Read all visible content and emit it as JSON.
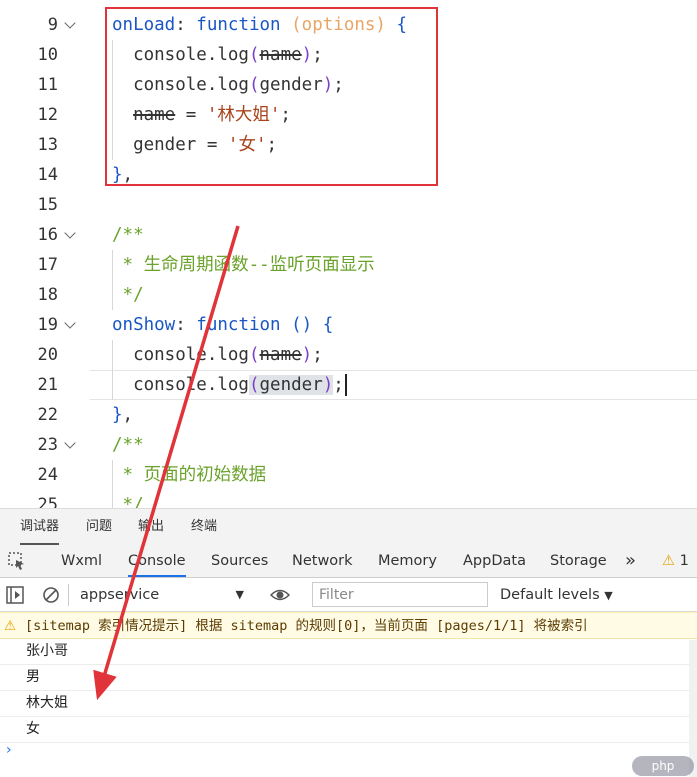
{
  "editor": {
    "lines": [
      {
        "num": "9",
        "fold": true,
        "html": "<span class=\"k\">onLoad</span>: <span class=\"k\">function</span> <span class=\"o\">(options)</span> <span class=\"k\">{</span>"
      },
      {
        "num": "10",
        "fold": false,
        "html": "  console.log<span class=\"p\">(</span><span class=\"del\">name</span><span class=\"p\">)</span>;"
      },
      {
        "num": "11",
        "fold": false,
        "html": "  console.log<span class=\"p\">(</span>gender<span class=\"p\">)</span>;"
      },
      {
        "num": "12",
        "fold": false,
        "html": "  <span class=\"del\">name</span> = <span class=\"s\">'林大姐'</span>;"
      },
      {
        "num": "13",
        "fold": false,
        "html": "  gender = <span class=\"s\">'女'</span>;"
      },
      {
        "num": "14",
        "fold": false,
        "html": "<span class=\"k\">}</span>,"
      },
      {
        "num": "15",
        "fold": false,
        "html": ""
      },
      {
        "num": "16",
        "fold": true,
        "html": "<span class=\"c\">/**</span>"
      },
      {
        "num": "17",
        "fold": false,
        "html": "<span class=\"c\"> * 生命周期函数--监听页面显示</span>"
      },
      {
        "num": "18",
        "fold": false,
        "html": "<span class=\"c\"> */</span>"
      },
      {
        "num": "19",
        "fold": true,
        "html": "<span class=\"k\">onShow</span>: <span class=\"k\">function</span> <span class=\"k\">() {</span>"
      },
      {
        "num": "20",
        "fold": false,
        "html": "  console.log<span class=\"p\">(</span><span class=\"del\">name</span><span class=\"p\">)</span>;"
      },
      {
        "num": "21",
        "fold": false,
        "html": "  console.log<span class=\"p hl\">(</span><span class=\"hl\">gender</span><span class=\"p hl\">)</span>;<span class=\"cursor\"></span>"
      },
      {
        "num": "22",
        "fold": false,
        "html": "<span class=\"k\">}</span>,"
      },
      {
        "num": "23",
        "fold": true,
        "html": "<span class=\"c\">/**</span>"
      },
      {
        "num": "24",
        "fold": false,
        "html": "<span class=\"c\"> * 页面的初始数据</span>"
      },
      {
        "num": "25",
        "fold": false,
        "html": "<span class=\"c\"> */</span>"
      }
    ]
  },
  "panel_tabs": [
    "调试器",
    "问题",
    "输出",
    "终端"
  ],
  "devtools_tabs": [
    "Wxml",
    "Console",
    "Sources",
    "Network",
    "Memory",
    "AppData",
    "Storage"
  ],
  "devtools_more": "»",
  "warning_count": "1",
  "console_toolbar": {
    "context": "appservice",
    "filter_placeholder": "Filter",
    "levels": "Default levels"
  },
  "console": {
    "warning": "[sitemap 索引情况提示] 根据 sitemap 的规则[0]，当前页面 [pages/1/1] 将被索引",
    "logs": [
      "张小哥",
      "男",
      "林大姐",
      "女"
    ],
    "prompt": "›"
  },
  "watermark": "php",
  "colors": {
    "highlight_box": "#e0333a",
    "arrow": "#e0333a",
    "active_tab": "#1a73e8",
    "warning_bg": "#fffbe5"
  }
}
